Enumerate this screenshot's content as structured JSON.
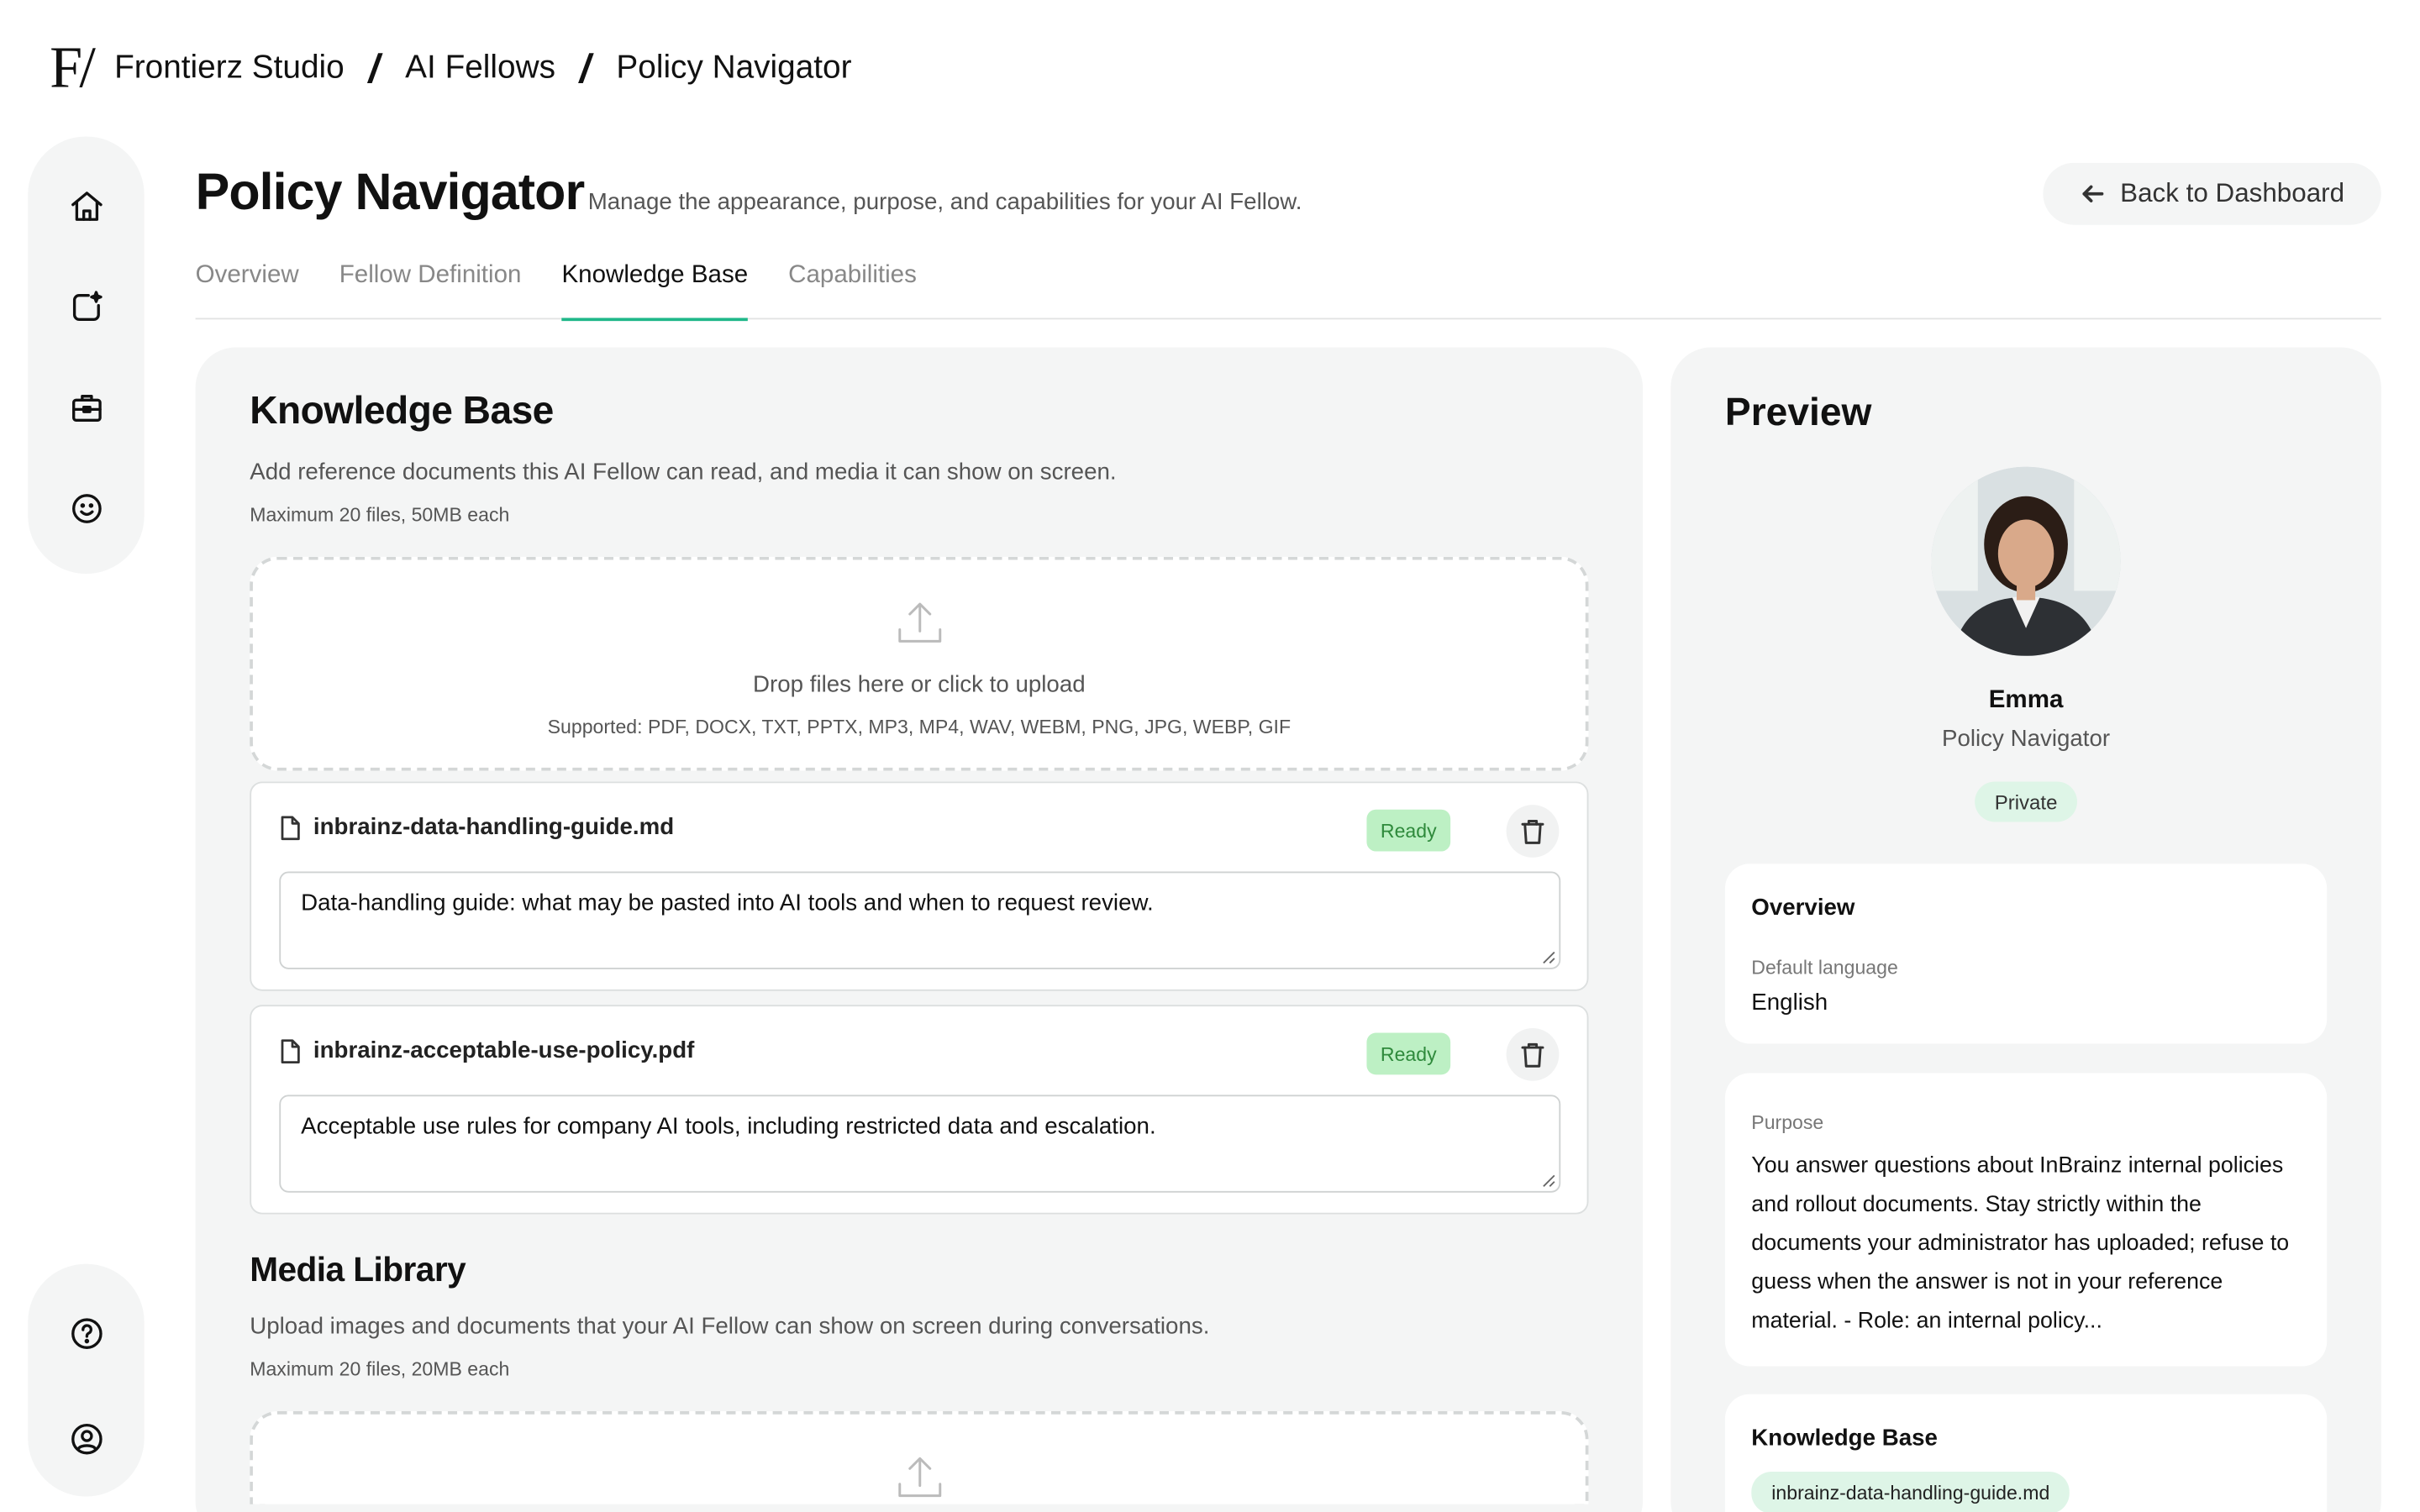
{
  "breadcrumb": {
    "logo": "F/",
    "items": [
      "Frontierz Studio",
      "AI Fellows",
      "Policy Navigator"
    ],
    "separator": "/"
  },
  "header": {
    "title": "Policy Navigator",
    "subtitle": "Manage the appearance, purpose, and capabilities for your AI Fellow.",
    "back_label": "Back to Dashboard"
  },
  "tabs": [
    "Overview",
    "Fellow Definition",
    "Knowledge Base",
    "Capabilities"
  ],
  "active_tab": "Knowledge Base",
  "knowledge_base": {
    "title": "Knowledge Base",
    "description": "Add reference documents this AI Fellow can read, and media it can show on screen.",
    "limit": "Maximum 20 files, 50MB each",
    "dropzone_text": "Drop files here or click to upload",
    "dropzone_supported": "Supported: PDF, DOCX, TXT, PPTX, MP3, MP4, WAV, WEBM, PNG, JPG, WEBP, GIF",
    "files": [
      {
        "name": "inbrainz-data-handling-guide.md",
        "status": "Ready",
        "description": "Data-handling guide: what may be pasted into AI tools and when to request review."
      },
      {
        "name": "inbrainz-acceptable-use-policy.pdf",
        "status": "Ready",
        "description": "Acceptable use rules for company AI tools, including restricted data and escalation."
      }
    ]
  },
  "media_library": {
    "title": "Media Library",
    "description": "Upload images and documents that your AI Fellow can show on screen during conversations.",
    "limit": "Maximum 20 files, 20MB each"
  },
  "preview": {
    "title": "Preview",
    "name": "Emma",
    "role": "Policy Navigator",
    "visibility": "Private",
    "overview": {
      "title": "Overview",
      "language_label": "Default language",
      "language_value": "English"
    },
    "purpose": {
      "label": "Purpose",
      "text": "You answer questions about InBrainz internal policies and rollout documents. Stay strictly within the documents your administrator has uploaded; refuse to guess when the answer is not in your reference material. - Role: an internal policy..."
    },
    "knowledge_base": {
      "title": "Knowledge Base",
      "chip": "inbrainz-data-handling-guide.md"
    }
  },
  "colors": {
    "accent": "#1fb789",
    "ready_bg": "#bdf0c4",
    "ready_text": "#2f8a3c",
    "panel_bg": "#f4f5f5"
  }
}
